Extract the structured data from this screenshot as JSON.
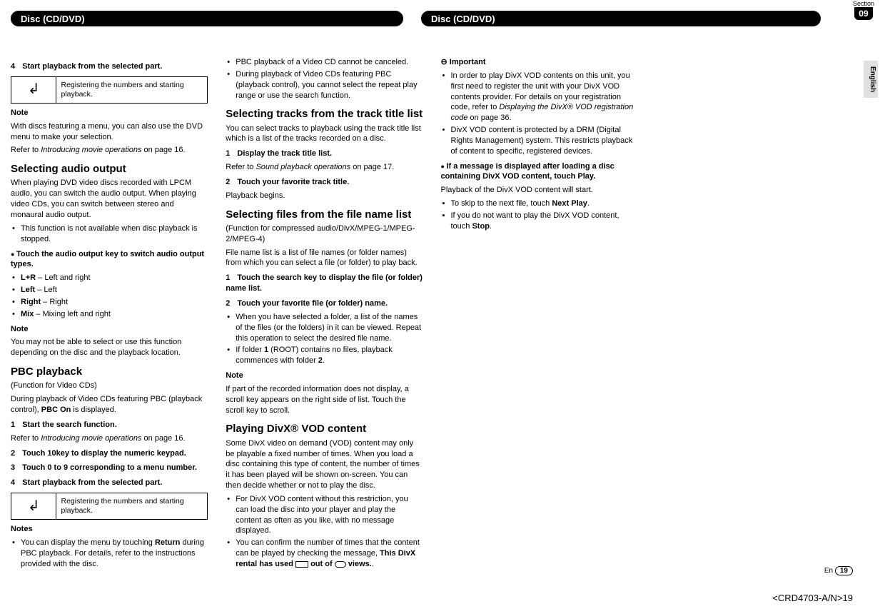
{
  "section": {
    "label": "Section",
    "num": "09"
  },
  "language": "English",
  "headers": {
    "left": "Disc (CD/DVD)",
    "right": "Disc (CD/DVD)"
  },
  "col1": {
    "step4": "Start playback from the selected part.",
    "iconDesc": "Registering the numbers and starting playback.",
    "noteHd": "Note",
    "noteBody1": "With discs featuring a menu, you can also use the DVD menu to make your selection.",
    "noteBody2a": "Refer to ",
    "noteBody2i": "Introducing movie operations",
    "noteBody2b": " on page 16.",
    "h2a": "Selecting audio output",
    "p1": "When playing DVD video discs recorded with LPCM audio, you can switch the audio output. When playing video CDs, you can switch between stereo and monaural audio output.",
    "b1": "This function is not available when disc playback is stopped.",
    "leadA": "Touch the audio output key to switch audio output types.",
    "optLR": "L+R",
    "optLRd": " – Left and right",
    "optL": "Left",
    "optLd": " – Left",
    "optR": "Right",
    "optRd": " – Right",
    "optM": "Mix",
    "optMd": " – Mixing left and right",
    "noteHd2": "Note",
    "noteBody3": "You may not be able to select or use this function depending on the disc and the playback location.",
    "h2b": "PBC playback",
    "p2a": "(Function for Video CDs)",
    "p2b": "During playback of Video CDs featuring PBC (playback control), ",
    "p2bBold": "PBC On",
    "p2c": " is displayed.",
    "step1b": "Start the search function.",
    "sub1a": "Refer to ",
    "sub1i": "Introducing movie operations",
    "sub1b": " on page 16."
  },
  "col2": {
    "step2": "Touch 10key to display the numeric keypad.",
    "step3": "Touch 0 to 9 corresponding to a menu number.",
    "step4": "Start playback from the selected part.",
    "iconDesc": "Registering the numbers and starting playback.",
    "notesHd": "Notes",
    "n1a": "You can display the menu by touching ",
    "n1b": "Return",
    "n1c": " during PBC playback. For details, refer to the instructions provided with the disc.",
    "n2": "PBC playback of a Video CD cannot be canceled.",
    "n3": "During playback of Video CDs featuring PBC (playback control), you cannot select the repeat play range or use the search function.",
    "h2a": "Selecting tracks from the track title list",
    "p1": "You can select tracks to playback using the track title list which is a list of the tracks recorded on a disc.",
    "step1b": "Display the track title list.",
    "sub1a": "Refer to ",
    "sub1i": "Sound playback operations",
    "sub1b": " on page 17.",
    "step2b": "Touch your favorite track title.",
    "sub2": "Playback begins.",
    "h2b": "Selecting files from the file name list",
    "p2": "(Function for compressed audio/DivX/MPEG-1/MPEG-2/MPEG-4)"
  },
  "col3": {
    "p0": "File name list is a list of file names (or folder names) from which you can select a file (or folder) to play back.",
    "step1": "Touch the search key to display the file (or folder) name list.",
    "step2": "Touch your favorite file (or folder) name.",
    "sq1": "When you have selected a folder, a list of the names of the files (or the folders) in it can be viewed. Repeat this operation to select the desired file name.",
    "sq2a": "If folder ",
    "sq2b": "1",
    "sq2c": " (ROOT) contains no files, playback commences with folder ",
    "sq2d": "2",
    "sq2e": ".",
    "noteHd": "Note",
    "noteBody": "If part of the recorded information does not display, a scroll key appears on the right side of list. Touch the scroll key to scroll.",
    "h2": "Playing DivX® VOD content",
    "p1": "Some DivX video on demand (VOD) content may only be playable a fixed number of times. When you load a disc containing this type of content, the number of times it has been played will be shown on-screen. You can then decide whether or not to play the disc.",
    "b1": "For DivX VOD content without this restriction, you can load the disc into your player and play the content as often as you like, with no message displayed.",
    "b2a": "You can confirm the number of times that the content can be played by checking the message, ",
    "b2b": "This DivX rental has used",
    "b2c": " out of ",
    "b2d": " views.",
    "impHd": "Important",
    "imp1a": "In order to play DivX VOD contents on this unit, you first need to register the unit with your DivX VOD contents provider. For details on your registration code, refer to ",
    "imp1i": "Displaying the DivX® VOD registration code",
    "imp1b": " on page 36."
  },
  "col4": {
    "b1": "DivX VOD content is protected by a DRM (Digital Rights Management) system. This restricts playback of content to specific, registered devices.",
    "leadA": "If a message is displayed after loading a disc containing DivX VOD content, touch Play.",
    "p1": "Playback of the DivX VOD content will start.",
    "sq1a": "To skip to the next file, touch ",
    "sq1b": "Next Play",
    "sq1c": ".",
    "sq2a": "If you do not want to play the DivX VOD content, touch ",
    "sq2b": "Stop",
    "sq2c": "."
  },
  "footer": {
    "lang": "En",
    "page": "19",
    "code": "<CRD4703-A/N>19"
  }
}
